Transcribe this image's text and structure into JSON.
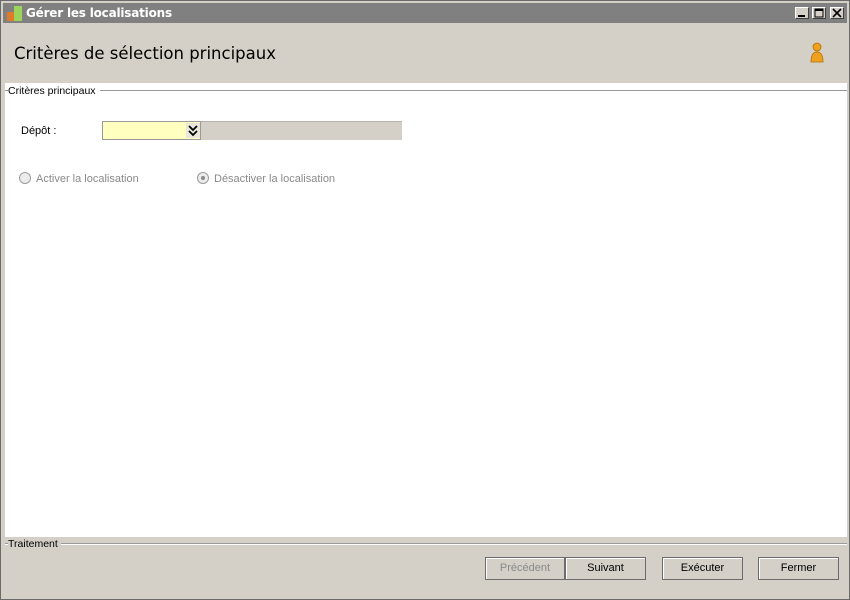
{
  "window": {
    "title": "Gérer les localisations"
  },
  "header": {
    "title": "Critères de sélection principaux"
  },
  "criteria": {
    "group_label": "Critères principaux",
    "depot_label": "Dépôt :",
    "depot_value": "",
    "radio_activate": "Activer la localisation",
    "radio_deactivate": "Désactiver la localisation",
    "selected": "deactivate"
  },
  "footer": {
    "group_label": "Traitement",
    "buttons": {
      "previous": "Précédent",
      "next": "Suivant",
      "execute": "Exécuter",
      "close": "Fermer"
    }
  },
  "colors": {
    "titlebar": "#808080",
    "background": "#d4d0c8",
    "combo_bg": "#ffffc0",
    "user_icon": "#f0a020"
  }
}
